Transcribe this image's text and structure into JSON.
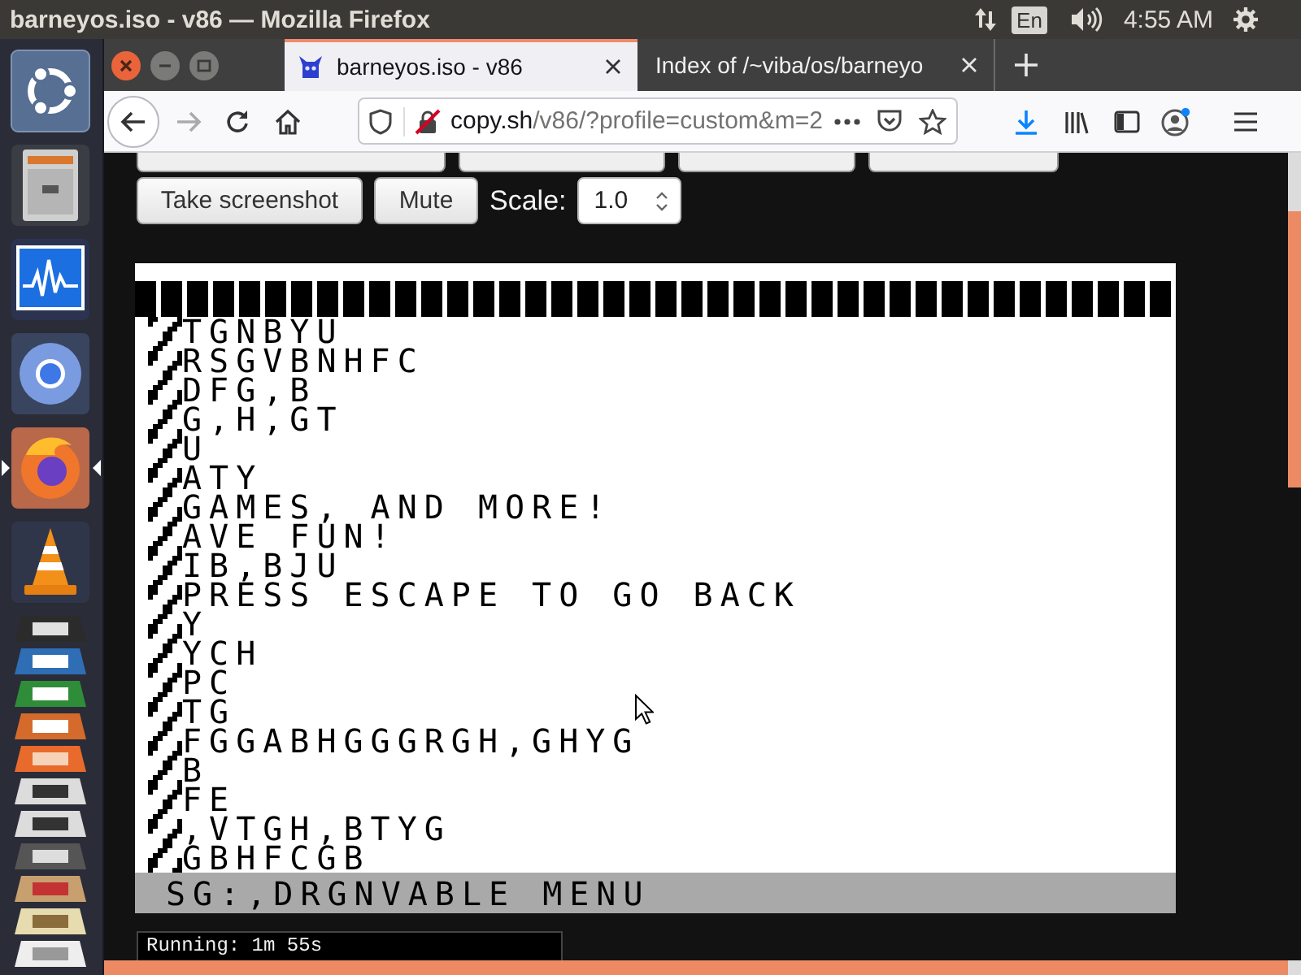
{
  "top_panel": {
    "title": "barneyos.iso - v86 — Mozilla Firefox",
    "keyboard_layout": "En",
    "clock": "4:55 AM"
  },
  "dock": {
    "items": [
      {
        "kind": "dash",
        "active": false
      },
      {
        "kind": "files",
        "active": false
      },
      {
        "kind": "monitor",
        "active": false
      },
      {
        "kind": "chromium",
        "active": false
      },
      {
        "kind": "firefox",
        "active": true
      },
      {
        "kind": "vlc",
        "active": false
      },
      {
        "kind": "terminal",
        "active": false
      },
      {
        "kind": "writer",
        "active": false
      },
      {
        "kind": "calc",
        "active": false
      },
      {
        "kind": "impress",
        "active": false
      },
      {
        "kind": "software",
        "active": false
      },
      {
        "kind": "disc",
        "active": false
      },
      {
        "kind": "disc",
        "active": false
      },
      {
        "kind": "camera",
        "active": false
      },
      {
        "kind": "editor",
        "active": false
      },
      {
        "kind": "photos",
        "active": false
      },
      {
        "kind": "drive",
        "active": false
      }
    ]
  },
  "browser": {
    "tabs": [
      {
        "title": "barneyos.iso - v86",
        "selected": true
      },
      {
        "title": "Index of /~viba/os/barneyo",
        "selected": false
      }
    ],
    "toolbar": {
      "back": {
        "disabled": false
      },
      "forward": {
        "disabled": true
      }
    },
    "address": {
      "host": "copy.sh",
      "path": "/v86/?profile=custom&m=2"
    }
  },
  "page": {
    "buttons": [
      "Take screenshot",
      "Mute"
    ],
    "scale": {
      "label": "Scale:",
      "value": "1.0"
    },
    "screen": {
      "lines": [
        "TGNBYU",
        "RSGVBNHFC",
        "DFG,B",
        "G,H,GT",
        "U",
        "ATY",
        "GAMES, AND MORE!",
        "AVE FUN!",
        "IB,BJU",
        "PRESS ESCAPE TO GO BACK",
        "Y",
        "YCH",
        "PC",
        "TG",
        "FGGABHGGGRGH,GHYG",
        "B",
        "FE",
        ",VTGH,BTYG",
        "GBHFCGB"
      ],
      "menu_bar": "SG:,DRGNVABLE MENU"
    },
    "status": "Running: 1m 55s"
  }
}
